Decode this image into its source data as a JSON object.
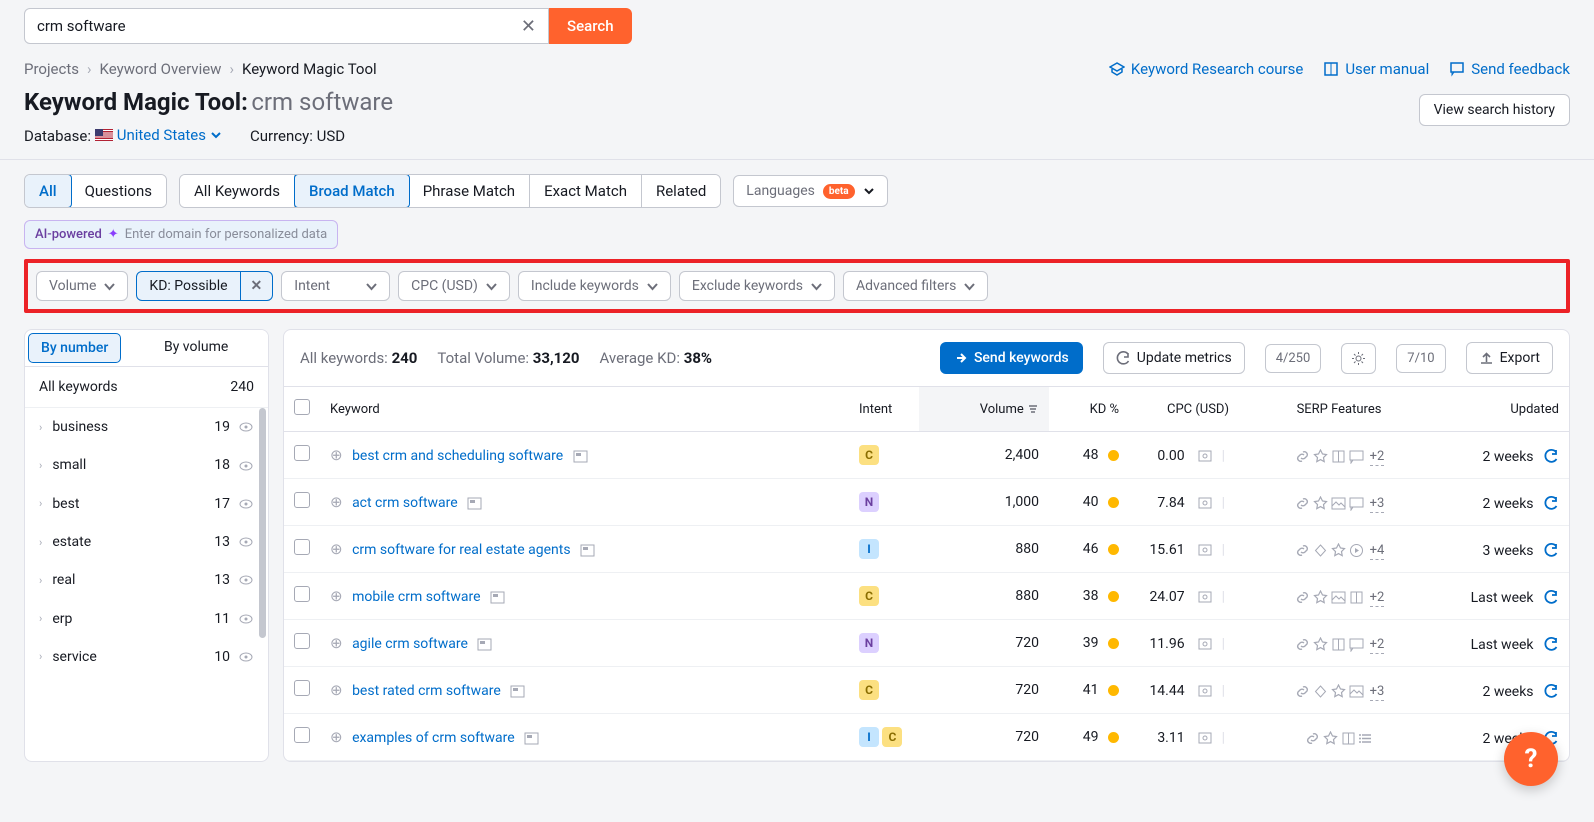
{
  "search": {
    "value": "crm software",
    "button": "Search"
  },
  "breadcrumbs": {
    "items": [
      "Projects",
      "Keyword Overview",
      "Keyword Magic Tool"
    ]
  },
  "title": {
    "name": "Keyword Magic Tool:",
    "subject": "crm software"
  },
  "database_label": "Database:",
  "database_value": "United States",
  "currency_label": "Currency:",
  "currency_value": "USD",
  "header_links": {
    "course": "Keyword Research course",
    "manual": "User manual",
    "feedback": "Send feedback",
    "history": "View search history"
  },
  "tabs1": {
    "all": "All",
    "questions": "Questions"
  },
  "tabs2": {
    "all_kw": "All Keywords",
    "broad": "Broad Match",
    "phrase": "Phrase Match",
    "exact": "Exact Match",
    "related": "Related"
  },
  "languages": {
    "label": "Languages",
    "badge": "beta"
  },
  "ai": {
    "chip": "AI-powered",
    "prompt": "Enter domain for personalized data"
  },
  "filters": {
    "volume": "Volume",
    "kd": "KD: Possible",
    "intent": "Intent",
    "cpc": "CPC (USD)",
    "include": "Include keywords",
    "exclude": "Exclude keywords",
    "advanced": "Advanced filters"
  },
  "sidebar": {
    "by_number": "By number",
    "by_volume": "By volume",
    "header_label": "All keywords",
    "header_count": "240",
    "items": [
      {
        "name": "business",
        "count": "19"
      },
      {
        "name": "small",
        "count": "18"
      },
      {
        "name": "best",
        "count": "17"
      },
      {
        "name": "estate",
        "count": "13"
      },
      {
        "name": "real",
        "count": "13"
      },
      {
        "name": "erp",
        "count": "11"
      },
      {
        "name": "service",
        "count": "10"
      }
    ]
  },
  "stats": {
    "all_kw_label": "All keywords:",
    "all_kw": "240",
    "vol_label": "Total Volume:",
    "vol": "33,120",
    "kd_label": "Average KD:",
    "kd": "38%",
    "send": "Send keywords",
    "update": "Update metrics",
    "update_count": "4/250",
    "gear_count": "7/10",
    "export": "Export"
  },
  "table": {
    "headers": {
      "keyword": "Keyword",
      "intent": "Intent",
      "volume": "Volume",
      "kd": "KD %",
      "cpc": "CPC (USD)",
      "serp": "SERP Features",
      "updated": "Updated"
    },
    "rows": [
      {
        "keyword": "best crm and scheduling software",
        "intent": [
          "C"
        ],
        "volume": "2,400",
        "kd": "48",
        "cpc": "0.00",
        "serp_more": "+2",
        "updated": "2 weeks"
      },
      {
        "keyword": "act crm software",
        "intent": [
          "N"
        ],
        "volume": "1,000",
        "kd": "40",
        "cpc": "7.84",
        "serp_more": "+3",
        "updated": "2 weeks"
      },
      {
        "keyword": "crm software for real estate agents",
        "intent": [
          "I"
        ],
        "volume": "880",
        "kd": "46",
        "cpc": "15.61",
        "serp_more": "+4",
        "updated": "3 weeks"
      },
      {
        "keyword": "mobile crm software",
        "intent": [
          "C"
        ],
        "volume": "880",
        "kd": "38",
        "cpc": "24.07",
        "serp_more": "+2",
        "updated": "Last week"
      },
      {
        "keyword": "agile crm software",
        "intent": [
          "N"
        ],
        "volume": "720",
        "kd": "39",
        "cpc": "11.96",
        "serp_more": "+2",
        "updated": "Last week"
      },
      {
        "keyword": "best rated crm software",
        "intent": [
          "C"
        ],
        "volume": "720",
        "kd": "41",
        "cpc": "14.44",
        "serp_more": "+3",
        "updated": "2 weeks"
      },
      {
        "keyword": "examples of crm software",
        "intent": [
          "I",
          "C"
        ],
        "volume": "720",
        "kd": "49",
        "cpc": "3.11",
        "serp_more": "",
        "updated": "2 weeks"
      }
    ]
  }
}
